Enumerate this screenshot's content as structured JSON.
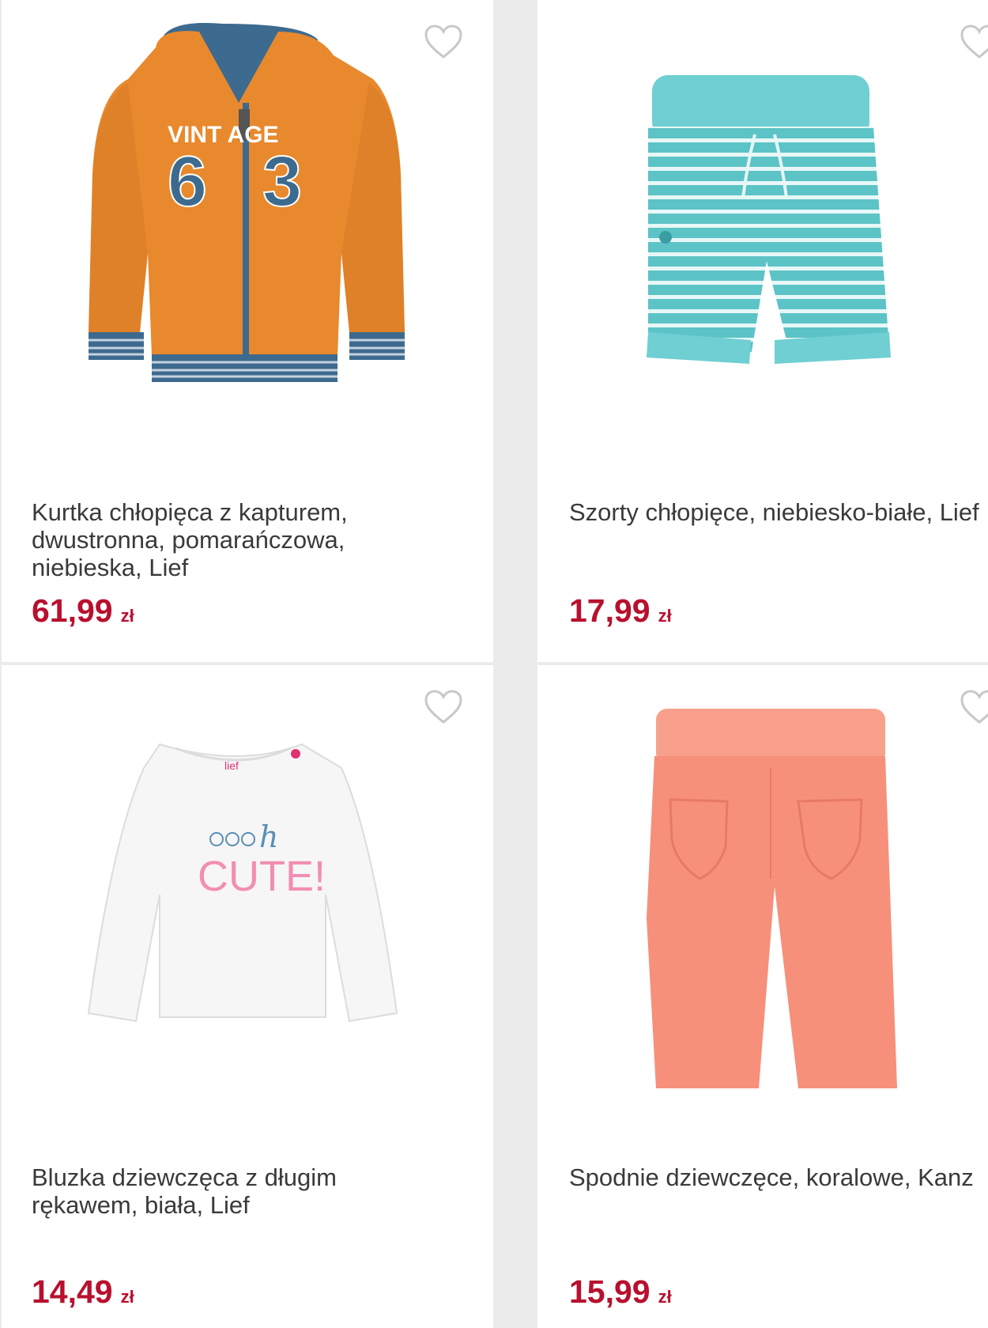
{
  "products": [
    {
      "name": "Kurtka chłopięca z kapturem, dwustronna, pomarańczowa, niebieska, Lief",
      "price": "61,99",
      "currency": "zł",
      "image_icon": "hooded-jacket-image",
      "print_text": "VINTAGE 63"
    },
    {
      "name": "Szorty chłopięce, niebiesko-białe, Lief",
      "price": "17,99",
      "currency": "zł",
      "image_icon": "striped-shorts-image"
    },
    {
      "name": "Bluzka dziewczęca z długim rękawem, biała, Lief",
      "price": "14,49",
      "currency": "zł",
      "image_icon": "long-sleeve-top-image",
      "print_text": "oooh CUTE!"
    },
    {
      "name": "Spodnie dziewczęce, koralowe, Kanz",
      "price": "15,99",
      "currency": "zł",
      "image_icon": "coral-trousers-image"
    }
  ],
  "colors": {
    "price": "#b8102e",
    "title": "#3a3a3a",
    "heart": "#c8c8c8",
    "jacket": "#e8892e",
    "jacket_blue": "#3d6a8f",
    "shorts": "#5cc3c6",
    "trousers": "#f6907a"
  }
}
